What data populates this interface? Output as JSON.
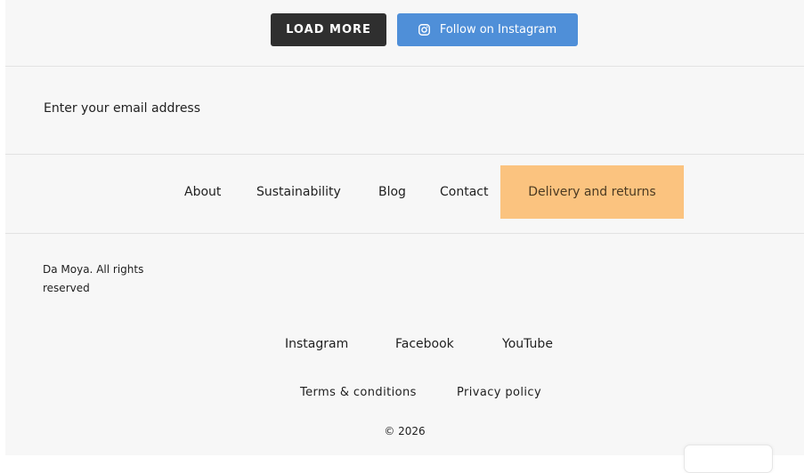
{
  "actions": {
    "load_more_label": "LOAD MORE",
    "follow_label": "Follow on Instagram",
    "follow_icon": "instagram-icon"
  },
  "newsletter": {
    "email_placeholder": "Enter your email address"
  },
  "footer_nav": {
    "items": [
      {
        "label": "About"
      },
      {
        "label": "Sustainability"
      },
      {
        "label": "Blog"
      },
      {
        "label": "Contact"
      },
      {
        "label": "Delivery and returns"
      }
    ],
    "highlight_color": "#fbc37f"
  },
  "brand": {
    "copyright_text": "Da Moya. All rights reserved"
  },
  "social": {
    "items": [
      {
        "label": "Instagram"
      },
      {
        "label": "Facebook"
      },
      {
        "label": "YouTube"
      }
    ]
  },
  "legal": {
    "items": [
      {
        "label": "Terms & conditions"
      },
      {
        "label": "Privacy policy"
      }
    ],
    "year_text": "© 2026"
  },
  "colors": {
    "load_more_bg": "#2f2f2f",
    "instagram_button_bg": "#4f8fd8",
    "page_bg": "#f7f7f7"
  }
}
